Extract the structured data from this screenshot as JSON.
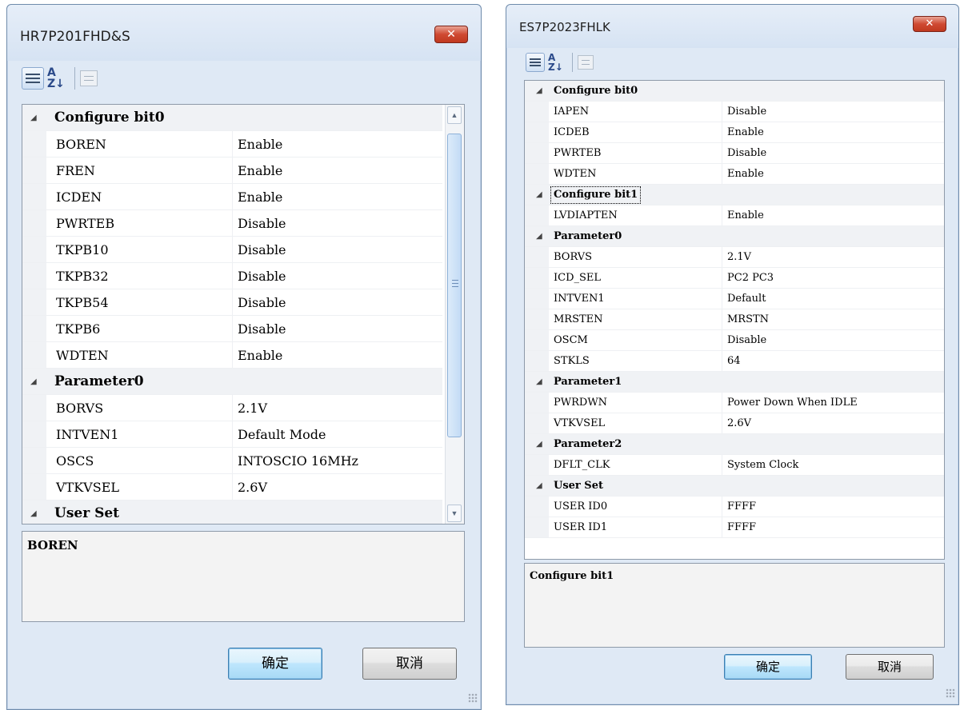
{
  "dialog1": {
    "title": "HR7P201FHD&S",
    "close_label": "✕",
    "rows": [
      {
        "type": "cat",
        "name": "Configure bit0"
      },
      {
        "type": "prop",
        "name": "BOREN",
        "value": "Enable"
      },
      {
        "type": "prop",
        "name": "FREN",
        "value": "Enable"
      },
      {
        "type": "prop",
        "name": "ICDEN",
        "value": "Enable"
      },
      {
        "type": "prop",
        "name": "PWRTEB",
        "value": "Disable"
      },
      {
        "type": "prop",
        "name": "TKPB10",
        "value": "Disable"
      },
      {
        "type": "prop",
        "name": "TKPB32",
        "value": "Disable"
      },
      {
        "type": "prop",
        "name": "TKPB54",
        "value": "Disable"
      },
      {
        "type": "prop",
        "name": "TKPB6",
        "value": "Disable"
      },
      {
        "type": "prop",
        "name": "WDTEN",
        "value": "Enable"
      },
      {
        "type": "cat",
        "name": "Parameter0"
      },
      {
        "type": "prop",
        "name": "BORVS",
        "value": "2.1V"
      },
      {
        "type": "prop",
        "name": "INTVEN1",
        "value": "Default Mode"
      },
      {
        "type": "prop",
        "name": "OSCS",
        "value": "INTOSCIO 16MHz"
      },
      {
        "type": "prop",
        "name": "VTKVSEL",
        "value": "2.6V"
      },
      {
        "type": "cat",
        "name": "User Set"
      }
    ],
    "description": "BOREN",
    "ok_label": "确定",
    "cancel_label": "取消"
  },
  "dialog2": {
    "title": "ES7P2023FHLK",
    "close_label": "✕",
    "rows": [
      {
        "type": "cat",
        "name": "Configure bit0"
      },
      {
        "type": "prop",
        "name": "IAPEN",
        "value": "Disable"
      },
      {
        "type": "prop",
        "name": "ICDEB",
        "value": "Enable"
      },
      {
        "type": "prop",
        "name": "PWRTEB",
        "value": "Disable"
      },
      {
        "type": "prop",
        "name": "WDTEN",
        "value": "Enable"
      },
      {
        "type": "cat",
        "name": "Configure bit1",
        "focused": true
      },
      {
        "type": "prop",
        "name": "LVDIAPTEN",
        "value": "Enable"
      },
      {
        "type": "cat",
        "name": "Parameter0"
      },
      {
        "type": "prop",
        "name": "BORVS",
        "value": "2.1V"
      },
      {
        "type": "prop",
        "name": "ICD_SEL",
        "value": "PC2 PC3"
      },
      {
        "type": "prop",
        "name": "INTVEN1",
        "value": "Default"
      },
      {
        "type": "prop",
        "name": "MRSTEN",
        "value": "MRSTN"
      },
      {
        "type": "prop",
        "name": "OSCM",
        "value": "Disable"
      },
      {
        "type": "prop",
        "name": "STKLS",
        "value": "64"
      },
      {
        "type": "cat",
        "name": "Parameter1"
      },
      {
        "type": "prop",
        "name": "PWRDWN",
        "value": "Power Down When IDLE"
      },
      {
        "type": "prop",
        "name": "VTKVSEL",
        "value": "2.6V"
      },
      {
        "type": "cat",
        "name": "Parameter2"
      },
      {
        "type": "prop",
        "name": "DFLT_CLK",
        "value": "System Clock"
      },
      {
        "type": "cat",
        "name": "User Set"
      },
      {
        "type": "prop",
        "name": "USER ID0",
        "value": "FFFF"
      },
      {
        "type": "prop",
        "name": "USER ID1",
        "value": "FFFF"
      }
    ],
    "description": "Configure bit1",
    "ok_label": "确定",
    "cancel_label": "取消"
  },
  "icons": {
    "categorized": "categorized-view-icon",
    "alphabetical": "alphabetical-sort-icon",
    "property_pages": "property-pages-icon",
    "collapse": "collapse-triangle-icon"
  },
  "colors": {
    "dialog_bg": "#dfe9f5",
    "close_button": "#c9442c",
    "category_row_bg": "#f0f2f5",
    "default_button_border": "#3c7fb1"
  }
}
